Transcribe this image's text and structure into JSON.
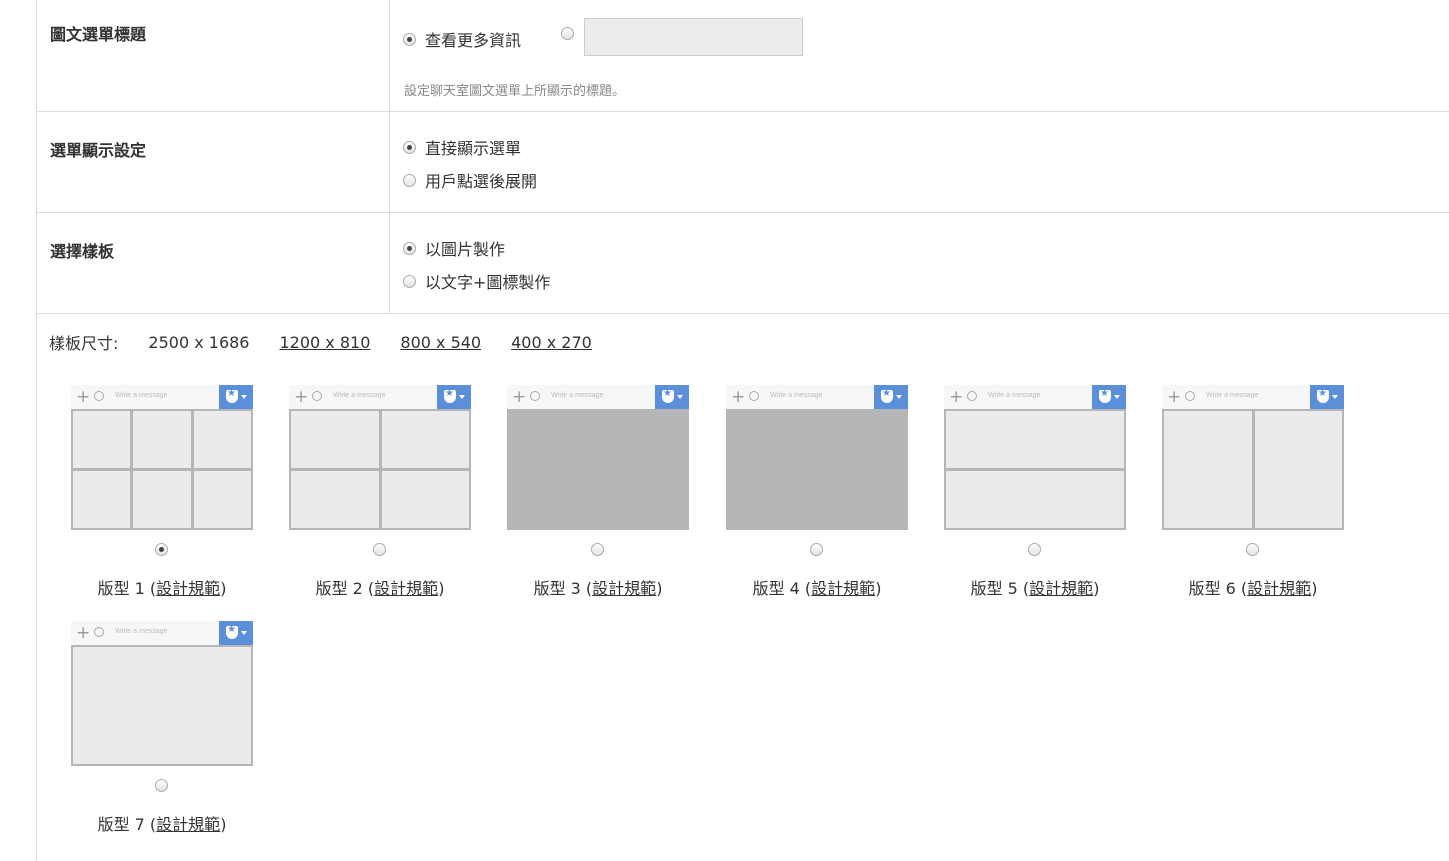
{
  "title_row": {
    "label": "圖文選單標題",
    "option_preset": "查看更多資訊",
    "custom_input_value": "",
    "hint": "設定聊天室圖文選單上所顯示的標題。"
  },
  "display_row": {
    "label": "選單顯示設定",
    "option_direct": "直接顯示選單",
    "option_tap": "用戶點選後展開"
  },
  "template_row": {
    "label": "選擇樣板",
    "option_image": "以圖片製作",
    "option_text_icon": "以文字+圖標製作"
  },
  "sizes": {
    "label": "樣板尺寸:",
    "options": [
      "2500 x 1686",
      "1200 x 810",
      "800 x 540",
      "400 x 270"
    ],
    "selected": "2500 x 1686"
  },
  "mock": {
    "input_placeholder": "Write a message",
    "plus": "+",
    "toggle_icon": "shield-star-icon",
    "accent_color": "#5b8fd9"
  },
  "templates": [
    {
      "prefix": "版型 1 (",
      "link": "設計規範",
      "suffix": ")",
      "selected": true
    },
    {
      "prefix": "版型 2 (",
      "link": "設計規範",
      "suffix": ")",
      "selected": false
    },
    {
      "prefix": "版型 3 (",
      "link": "設計規範",
      "suffix": ")",
      "selected": false
    },
    {
      "prefix": "版型 4 (",
      "link": "設計規範",
      "suffix": ")",
      "selected": false
    },
    {
      "prefix": "版型 5 (",
      "link": "設計規範",
      "suffix": ")",
      "selected": false
    },
    {
      "prefix": "版型 6 (",
      "link": "設計規範",
      "suffix": ")",
      "selected": false
    },
    {
      "prefix": "版型 7 (",
      "link": "設計規範",
      "suffix": ")",
      "selected": false
    }
  ]
}
